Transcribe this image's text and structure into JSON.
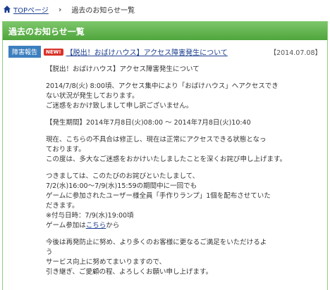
{
  "breadcrumb": {
    "home_label": "TOPページ",
    "separator": "›",
    "current": "過去のお知らせ一覧"
  },
  "panel": {
    "title": "過去のお知らせ一覧"
  },
  "news": {
    "category": "障害報告",
    "new_badge": "NEW!",
    "title": "【脱出！おばけハウス】アクセス障害発生について",
    "date": "【2014.07.08】"
  },
  "article": {
    "heading": "【脱出！おばけハウス】アクセス障害発生について",
    "p1": "2014/7/8(火) 8:00頃、アクセス集中により「おばけハウス」へアクセスでき\nない状況が発生しております。\nご迷惑をおかけ致しまして申し訳ございません。",
    "p2": "【発生期間】2014年7月8日(火)08:00 ～ 2014年7月8日(火)10:40",
    "p3": "現在、こちらの不具合は修正し、現在は正常にアクセスできる状態となっ\nております。\nこの度は、多大なご迷惑をおかけいたしましたことを深くお詫び申し上げます。",
    "p4": "つきましては、このたびのお詫びといたしまして、\n7/2(水)16:00～7/9(水)15:59の期間中に一回でも\nゲームに参加されたユーザー様全員「手作りランプ」1個を配布させていた\nだきます。\n※付与日時：7/9(水)19:00頃",
    "p4_link_prefix": "ゲーム参加は",
    "p4_link": "こちら",
    "p4_link_suffix": "から",
    "p5": "今後は再発防止に努め、より多くのお客様に更なるご満足をいただけるよ\nう\nサービス向上に努めてまいりますので、\n引き継ぎ、ご愛顧の程、よろしくお願い申し上げます。"
  },
  "colors": {
    "header_green": "#5fb04c",
    "link_blue": "#1a3d8f",
    "category_blue": "#3c7fbf",
    "new_red": "#d9342b"
  },
  "icons": {
    "home": "home-icon"
  }
}
